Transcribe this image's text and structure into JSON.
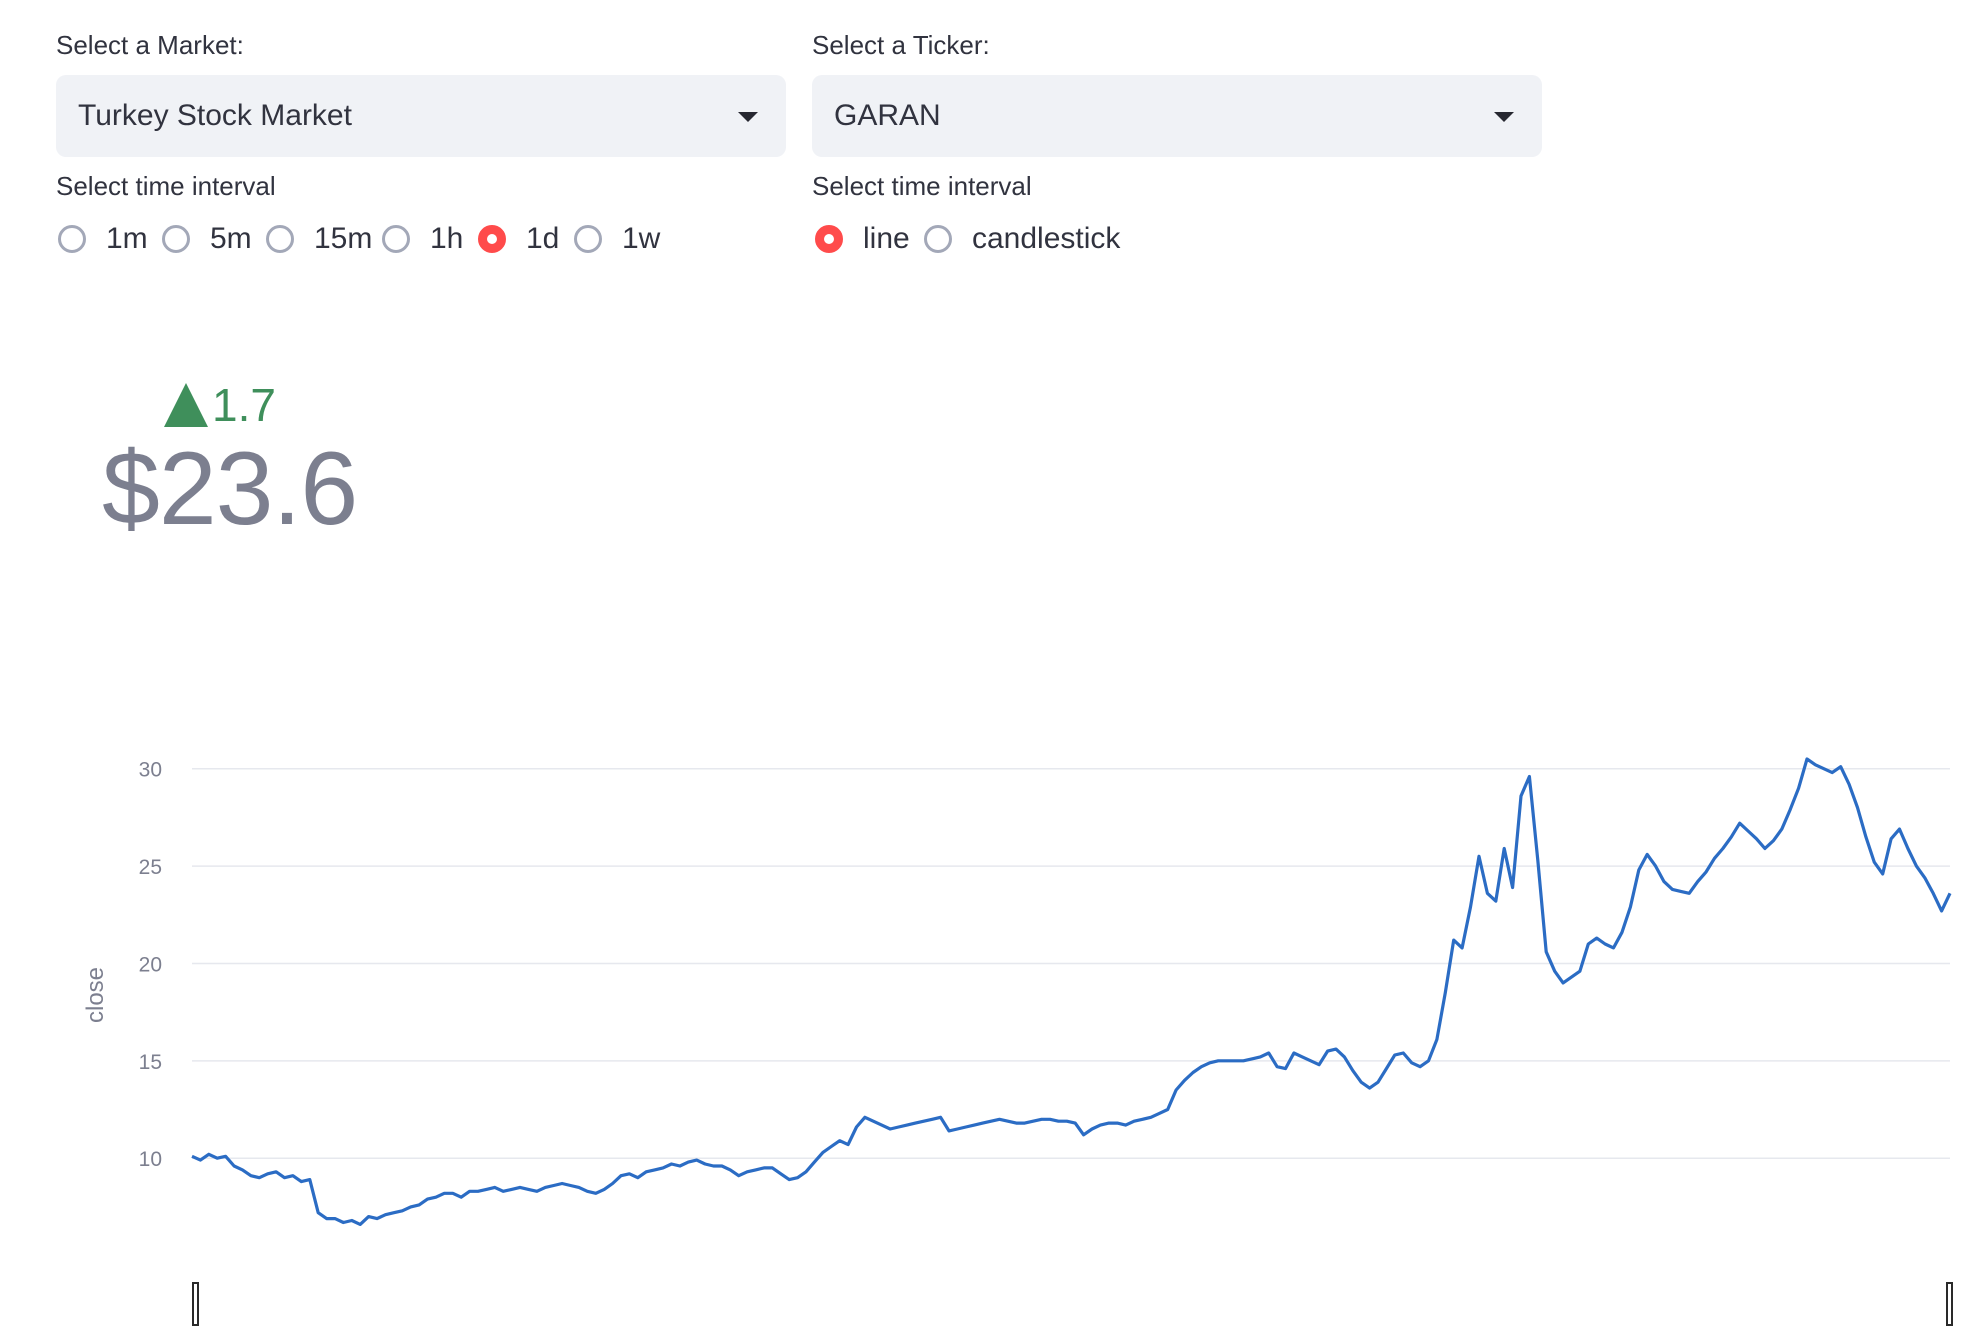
{
  "market": {
    "label": "Select a Market:",
    "value": "Turkey Stock Market"
  },
  "ticker": {
    "label": "Select a Ticker:",
    "value": "GARAN"
  },
  "interval": {
    "label": "Select time interval",
    "options": [
      "1m",
      "5m",
      "15m",
      "1h",
      "1d",
      "1w"
    ],
    "selected": "1d"
  },
  "chart_type": {
    "label": "Select time interval",
    "options": [
      "line",
      "candlestick"
    ],
    "selected": "line"
  },
  "metric": {
    "delta": "1.7",
    "value": "$23.6"
  },
  "colors": {
    "accent": "#ff4b4b",
    "line": "#2b6cc4",
    "delta_positive": "#3f8f5b",
    "metric": "#7c7f8f"
  },
  "chart_data": {
    "type": "line",
    "title": "",
    "xlabel": "",
    "ylabel": "close",
    "ylim": [
      5.8,
      32.5
    ],
    "yticks": [
      10,
      15,
      20,
      25,
      30
    ],
    "grid": true,
    "series": [
      {
        "values": [
          10.1,
          9.9,
          10.2,
          10.0,
          10.1,
          9.6,
          9.4,
          9.1,
          9.0,
          9.2,
          9.3,
          9.0,
          9.1,
          8.8,
          8.9,
          7.2,
          6.9,
          6.9,
          6.7,
          6.8,
          6.6,
          7.0,
          6.9,
          7.1,
          7.2,
          7.3,
          7.5,
          7.6,
          7.9,
          8.0,
          8.2,
          8.2,
          8.0,
          8.3,
          8.3,
          8.4,
          8.5,
          8.3,
          8.4,
          8.5,
          8.4,
          8.3,
          8.5,
          8.6,
          8.7,
          8.6,
          8.5,
          8.3,
          8.2,
          8.4,
          8.7,
          9.1,
          9.2,
          9.0,
          9.3,
          9.4,
          9.5,
          9.7,
          9.6,
          9.8,
          9.9,
          9.7,
          9.6,
          9.6,
          9.4,
          9.1,
          9.3,
          9.4,
          9.5,
          9.5,
          9.2,
          8.9,
          9.0,
          9.3,
          9.8,
          10.3,
          10.6,
          10.9,
          10.7,
          11.6,
          12.1,
          11.9,
          11.7,
          11.5,
          11.6,
          11.7,
          11.8,
          11.9,
          12.0,
          12.1,
          11.4,
          11.5,
          11.6,
          11.7,
          11.8,
          11.9,
          12.0,
          11.9,
          11.8,
          11.8,
          11.9,
          12.0,
          12.0,
          11.9,
          11.9,
          11.8,
          11.2,
          11.5,
          11.7,
          11.8,
          11.8,
          11.7,
          11.9,
          12.0,
          12.1,
          12.3,
          12.5,
          13.5,
          14.0,
          14.4,
          14.7,
          14.9,
          15.0,
          15.0,
          15.0,
          15.0,
          15.1,
          15.2,
          15.4,
          14.7,
          14.6,
          15.4,
          15.2,
          15.0,
          14.8,
          15.5,
          15.6,
          15.2,
          14.5,
          13.9,
          13.6,
          13.9,
          14.6,
          15.3,
          15.4,
          14.9,
          14.7,
          15.0,
          16.1,
          18.5,
          21.2,
          20.8,
          22.9,
          25.5,
          23.6,
          23.2,
          25.9,
          23.9,
          28.6,
          29.6,
          25.3,
          20.6,
          19.6,
          19.0,
          19.3,
          19.6,
          21.0,
          21.3,
          21.0,
          20.8,
          21.6,
          22.9,
          24.8,
          25.6,
          25.0,
          24.2,
          23.8,
          23.7,
          23.6,
          24.2,
          24.7,
          25.4,
          25.9,
          26.5,
          27.2,
          26.8,
          26.4,
          25.9,
          26.3,
          26.9,
          27.9,
          29.0,
          30.5,
          30.2,
          30.0,
          29.8,
          30.1,
          29.2,
          28.0,
          26.5,
          25.2,
          24.6,
          26.4,
          26.9,
          25.9,
          25.0,
          24.4,
          23.6,
          22.7,
          23.6
        ]
      }
    ]
  }
}
